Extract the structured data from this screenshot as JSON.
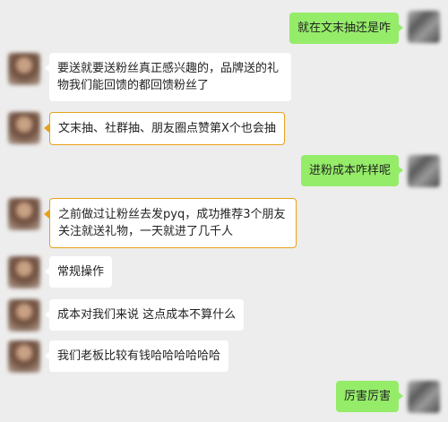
{
  "messages": [
    {
      "sender": "me",
      "text": "就在文末抽还是咋"
    },
    {
      "sender": "friend",
      "text": "要送就要送粉丝真正感兴趣的，品牌送的礼物我们能回馈的都回馈粉丝了"
    },
    {
      "sender": "friend",
      "text": "文末抽、社群抽、朋友圈点赞第X个也会抽",
      "highlighted": true
    },
    {
      "sender": "me",
      "text": "进粉成本咋样呢"
    },
    {
      "sender": "friend",
      "text": "之前做过让粉丝去发pyq，成功推荐3个朋友关注就送礼物，一天就进了几千人",
      "highlighted": true
    },
    {
      "sender": "friend",
      "text": "常规操作"
    },
    {
      "sender": "friend",
      "text": "成本对我们来说 这点成本不算什么"
    },
    {
      "sender": "friend",
      "text": "我们老板比较有钱哈哈哈哈哈哈"
    },
    {
      "sender": "me",
      "text": "厉害厉害"
    }
  ],
  "colors": {
    "background": "#ededed",
    "friend_bubble": "#ffffff",
    "my_bubble": "#95ec69",
    "highlight_border": "#e8a21a"
  }
}
